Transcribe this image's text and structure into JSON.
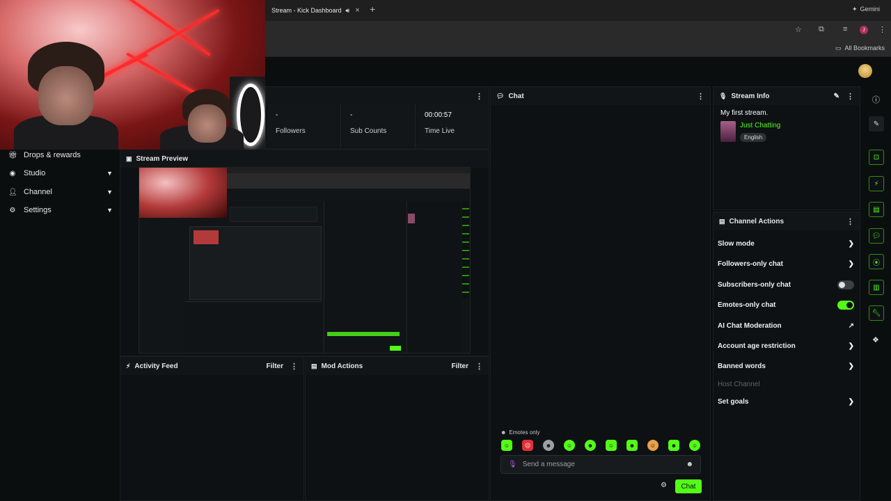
{
  "browser": {
    "tab_title": "Stream - Kick Dashboard",
    "new_tab": "+",
    "gemini": "Gemini",
    "all_bookmarks": "All Bookmarks"
  },
  "sidebar": {
    "items": [
      {
        "label": "Drops & rewards",
        "icon": "gift-icon"
      },
      {
        "label": "Studio",
        "icon": "studio-icon"
      },
      {
        "label": "Channel",
        "icon": "channel-icon"
      },
      {
        "label": "Settings",
        "icon": "gear-icon"
      }
    ]
  },
  "stats": {
    "followers_value": "-",
    "followers_label": "Followers",
    "subs_value": "-",
    "subs_label": "Sub Counts",
    "time_value": "00:00:57",
    "time_label": "Time Live"
  },
  "preview": {
    "title": "Stream Preview"
  },
  "activity": {
    "title": "Activity Feed",
    "filter": "Filter"
  },
  "mod": {
    "title": "Mod Actions",
    "filter": "Filter"
  },
  "chat": {
    "title": "Chat",
    "mode_label": "Emotes only",
    "placeholder": "Send a message",
    "send_label": "Chat"
  },
  "stream_info": {
    "title": "Stream Info",
    "stream_title": "My first stream.",
    "category": "Just Chatting",
    "language": "English"
  },
  "channel_actions": {
    "title": "Channel Actions",
    "items": [
      {
        "label": "Slow mode",
        "control": "chevron"
      },
      {
        "label": "Followers-only chat",
        "control": "chevron"
      },
      {
        "label": "Subscribers-only chat",
        "control": "toggle",
        "on": false
      },
      {
        "label": "Emotes-only chat",
        "control": "toggle",
        "on": true
      },
      {
        "label": "AI Chat Moderation",
        "control": "external"
      },
      {
        "label": "Account age restriction",
        "control": "chevron"
      },
      {
        "label": "Banned words",
        "control": "chevron"
      },
      {
        "label": "Host Channel",
        "control": "none",
        "disabled": true
      },
      {
        "label": "Set goals",
        "control": "chevron"
      }
    ]
  },
  "colors": {
    "accent": "#53fc18",
    "bg": "#0b0e0f",
    "panel": "#0d1113"
  }
}
